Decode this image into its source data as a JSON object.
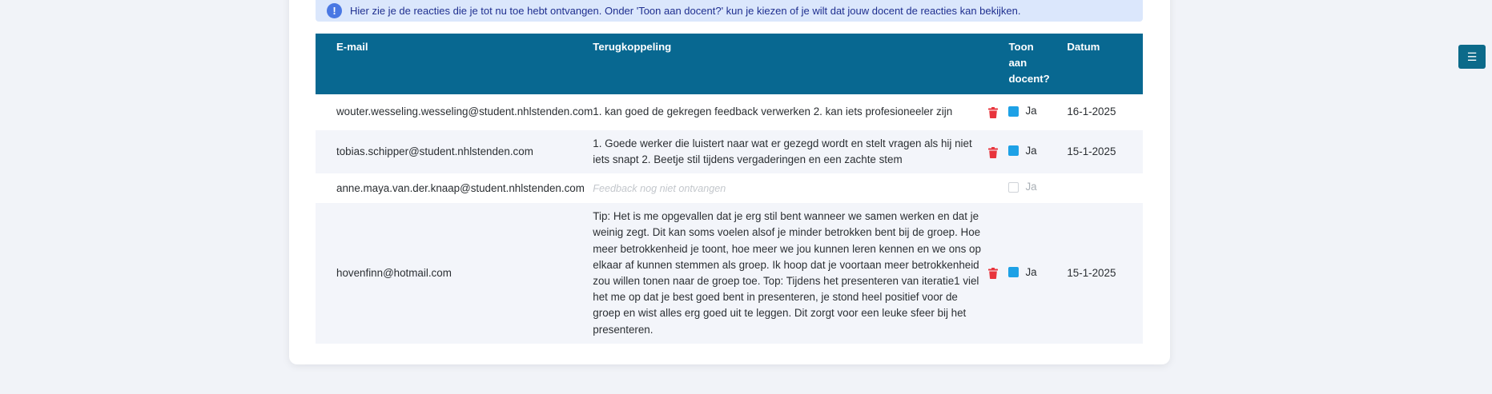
{
  "info": {
    "icon": "exclamation-icon",
    "text": "Hier zie je de reacties die je tot nu toe hebt ontvangen. Onder 'Toon aan docent?' kun je kiezen of je wilt dat jouw docent de reacties kan bekijken."
  },
  "table": {
    "headers": {
      "email": "E-mail",
      "feedback": "Terugkoppeling",
      "show": "Toon aan docent?",
      "date": "Datum"
    },
    "rows": [
      {
        "email": "wouter.wesseling.wesseling@student.nhlstenden.com",
        "feedback": "1. kan goed de gekregen feedback verwerken 2. kan iets profesioneeler zijn",
        "show_label": "Ja",
        "shown": true,
        "date": "16-1-2025"
      },
      {
        "email": "tobias.schipper@student.nhlstenden.com",
        "feedback": "1. Goede werker die luistert naar wat er gezegd wordt en stelt vragen als hij niet iets snapt 2. Beetje stil tijdens vergaderingen en een zachte stem",
        "show_label": "Ja",
        "shown": true,
        "date": "15-1-2025"
      },
      {
        "email": "anne.maya.van.der.knaap@student.nhlstenden.com",
        "feedback": "Feedback nog niet ontvangen",
        "show_label": "Ja",
        "shown": false,
        "date": ""
      },
      {
        "email": "hovenfinn@hotmail.com",
        "feedback": "Tip: Het is me opgevallen dat je erg stil bent wanneer we samen werken en dat je weinig zegt. Dit kan soms voelen alsof je minder betrokken bent bij de groep. Hoe meer betrokkenheid je toont, hoe meer we jou kunnen leren kennen en we ons op elkaar af kunnen stemmen als groep. Ik hoop dat je voortaan meer betrokkenheid zou willen tonen naar de groep toe. Top: Tijdens het presenteren van iteratie1 viel het me op dat je best goed bent in presenteren, je stond heel positief voor de groep en wist alles erg goed uit te leggen. Dit zorgt voor een leuke sfeer bij het presenteren.",
        "show_label": "Ja",
        "shown": true,
        "date": "15-1-2025"
      }
    ]
  },
  "sidebar_toggle": {
    "icon": "hamburger-menu-icon"
  },
  "colors": {
    "header_bg": "#086891",
    "info_bg": "#dbe7fc",
    "delete": "#e8343c",
    "checkbox_on": "#1da1e6"
  }
}
